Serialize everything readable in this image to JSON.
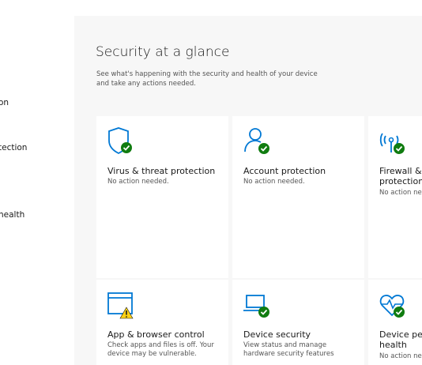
{
  "sidebar": {
    "items": [
      {
        "label": "on"
      },
      {
        "label": "tection"
      },
      {
        "label": "health"
      }
    ]
  },
  "main": {
    "title": "Security at a glance",
    "subtitle": "See what's happening with the security and health of your device and take any actions needed."
  },
  "tiles": [
    {
      "icon": "shield-icon",
      "status": "ok",
      "title": "Virus & threat protection",
      "desc": "No action needed."
    },
    {
      "icon": "account-icon",
      "status": "ok",
      "title": "Account protection",
      "desc": "No action needed."
    },
    {
      "icon": "wifi-signal-icon",
      "status": "ok",
      "title": "Firewall & network protection",
      "desc": "No action needed."
    },
    {
      "icon": "browser-window-icon",
      "status": "warning",
      "title": "App & browser control",
      "desc": "Check apps and files is off. Your device may be vulnerable."
    },
    {
      "icon": "laptop-icon",
      "status": "ok",
      "title": "Device security",
      "desc": "View status and manage hardware security features"
    },
    {
      "icon": "heart-pulse-icon",
      "status": "ok",
      "title": "Device performance & health",
      "desc": "No action needed."
    }
  ],
  "colors": {
    "accent": "#0078d4",
    "ok": "#107c10",
    "warning": "#fcd116"
  }
}
